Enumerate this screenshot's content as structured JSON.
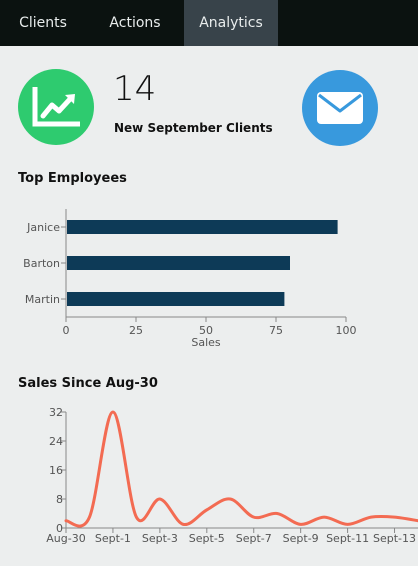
{
  "nav": {
    "tabs": [
      {
        "label": "Clients",
        "active": false
      },
      {
        "label": "Actions",
        "active": false
      },
      {
        "label": "Analytics",
        "active": true
      }
    ]
  },
  "summary": {
    "count": "14",
    "label": "New September Clients"
  },
  "icons": {
    "stats": "trending-up-chart-icon",
    "mail": "envelope-icon"
  },
  "colors": {
    "nav_bg": "#0b1210",
    "active_tab": "#38434a",
    "stats_green": "#2ecb6f",
    "mail_blue": "#3899dd",
    "bar_navy": "#0d3a57",
    "line_coral": "#f36b52"
  },
  "top_employees": {
    "title": "Top Employees"
  },
  "sales_since": {
    "title": "Sales Since Aug-30"
  },
  "chart_data": [
    {
      "type": "bar",
      "orientation": "horizontal",
      "categories": [
        "Janice",
        "Barton",
        "Martin"
      ],
      "values": [
        97,
        80,
        78
      ],
      "xlabel": "Sales",
      "ylabel": "",
      "xlim": [
        0,
        100
      ],
      "xticks": [
        0,
        25,
        50,
        75,
        100
      ],
      "grid": false
    },
    {
      "type": "line",
      "smooth": true,
      "x": [
        "Aug-30",
        "Aug-31",
        "Sept-1",
        "Sept-2",
        "Sept-3",
        "Sept-4",
        "Sept-5",
        "Sept-6",
        "Sept-7",
        "Sept-8",
        "Sept-9",
        "Sept-10",
        "Sept-11",
        "Sept-12",
        "Sept-13",
        "Sept-14"
      ],
      "xticks": [
        "Aug-30",
        "Sept-1",
        "Sept-3",
        "Sept-5",
        "Sept-7",
        "Sept-9",
        "Sept-11",
        "Sept-13"
      ],
      "values": [
        2,
        3,
        32,
        3,
        8,
        1,
        5,
        8,
        3,
        4,
        1,
        3,
        1,
        3,
        3,
        2
      ],
      "xlabel": "",
      "ylabel": "",
      "ylim": [
        0,
        32
      ],
      "yticks": [
        0,
        8,
        16,
        24,
        32
      ],
      "grid": false
    }
  ]
}
